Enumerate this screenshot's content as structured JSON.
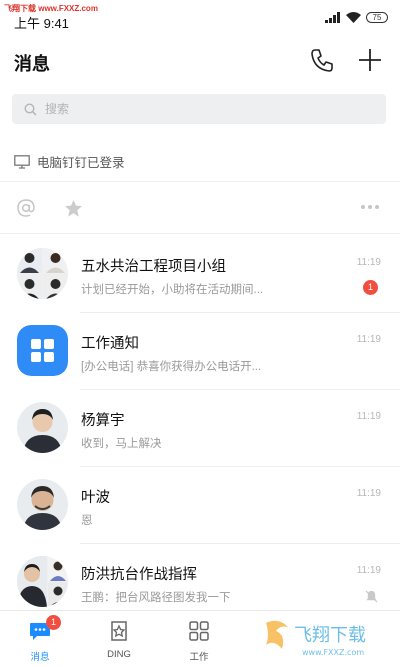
{
  "watermark": {
    "text": "飞翔下载 www.FXXZ.com"
  },
  "status_bar": {
    "time": "上午 9:41",
    "battery": "75"
  },
  "header": {
    "title": "消息",
    "phone_icon": "phone-icon",
    "add_icon": "plus-icon"
  },
  "search": {
    "placeholder": "搜索"
  },
  "pc_login": {
    "label": "电脑钉钉已登录"
  },
  "filters": {
    "at_icon": "at-icon",
    "star_icon": "star-icon",
    "more_icon": "more-icon"
  },
  "conversations": [
    {
      "name": "五水共治工程项目小组",
      "preview": "计划已经开始，小助将在活动期间...",
      "time": "11:19",
      "badge": "1"
    },
    {
      "name": "工作通知",
      "preview": "[办公电话] 恭喜你获得办公电话开...",
      "time": "11:19"
    },
    {
      "name": "杨算宇",
      "preview": "收到，马上解决",
      "time": "11:19"
    },
    {
      "name": "叶波",
      "preview": "恩",
      "time": "11:19"
    },
    {
      "name": "防洪抗台作战指挥",
      "preview": "王鹏：把台风路径图发我一下",
      "time": "11:19",
      "muted": true
    }
  ],
  "tabs": [
    {
      "label": "消息",
      "badge": "1",
      "active": true
    },
    {
      "label": "DING"
    },
    {
      "label": "工作"
    }
  ],
  "colors": {
    "accent": "#1b8cff",
    "badge": "#f24e40",
    "work_notice": "#2f8cf6"
  },
  "bottom_logo": {
    "text": "飞翔下载",
    "sub": "www.FXXZ.com"
  }
}
